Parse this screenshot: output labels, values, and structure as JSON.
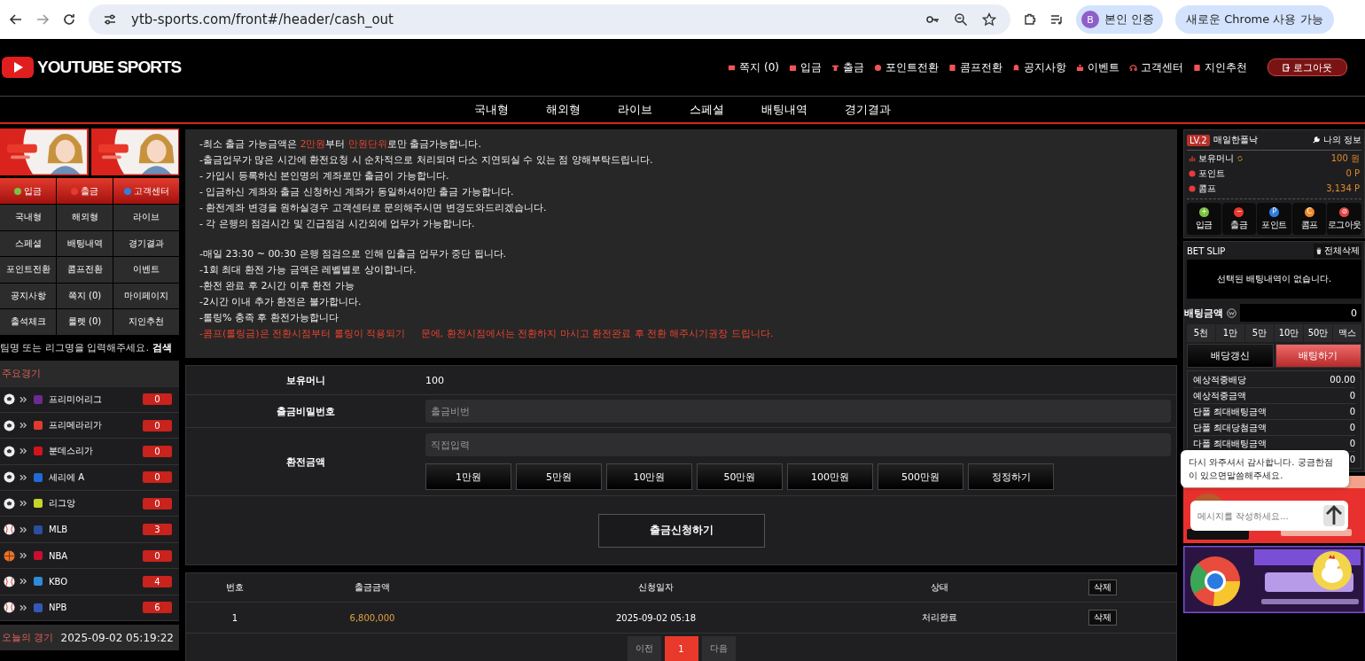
{
  "browser": {
    "url": "ytb-sports.com/front#/header/cash_out",
    "profile_initial": "B",
    "profile_label": "본인 인증",
    "update_label": "새로운 Chrome 사용 가능"
  },
  "header": {
    "logo": "YOUTUBE SPORTS",
    "links": [
      "쪽지 (0)",
      "입금",
      "출금",
      "포인트전환",
      "콤프전환",
      "공지사항",
      "이벤트",
      "고객센터",
      "지인추천"
    ],
    "logout": "로그아웃"
  },
  "menu": [
    "국내형",
    "해외형",
    "라이브",
    "스페셜",
    "배팅내역",
    "경기결과"
  ],
  "sidebar": {
    "banners": [
      {
        "kind": "picture"
      },
      {
        "kind": "picture"
      }
    ],
    "quick": [
      {
        "label": "입금",
        "color": "#7cc242"
      },
      {
        "label": "출금",
        "color": "#e8392b"
      },
      {
        "label": "고객센터",
        "color": "#2f7fe0"
      }
    ],
    "grid": [
      "국내형",
      "해외형",
      "라이브",
      "스페셜",
      "배팅내역",
      "경기결과",
      "포인트전환",
      "콤프전환",
      "이벤트",
      "공지사항",
      "쪽지 (0)",
      "마이페이지",
      "출석체크",
      "룰렛 (0)",
      "지인추천"
    ],
    "search": {
      "placeholder": "팀명 또는 리그명을 입력해주세요.",
      "button": "검색"
    },
    "major_title": "주요경기",
    "leagues": [
      {
        "kind": "soccer",
        "name": "프리미어리그",
        "count": "0",
        "color": "#6b2b8f"
      },
      {
        "kind": "soccer",
        "name": "프리메라리가",
        "count": "0",
        "color": "#e23b2e"
      },
      {
        "kind": "soccer",
        "name": "분데스리가",
        "count": "0",
        "color": "#d2141c"
      },
      {
        "kind": "soccer",
        "name": "세리에 A",
        "count": "0",
        "color": "#1e6bd6"
      },
      {
        "kind": "soccer",
        "name": "리그앙",
        "count": "0",
        "color": "#c7d42b"
      },
      {
        "kind": "baseball",
        "name": "MLB",
        "count": "3",
        "color": "#2a4ea0"
      },
      {
        "kind": "basketball",
        "name": "NBA",
        "count": "0",
        "color": "#c8102e"
      },
      {
        "kind": "baseball",
        "name": "KBO",
        "count": "4",
        "color": "#2e8bd9"
      },
      {
        "kind": "baseball",
        "name": "NPB",
        "count": "6",
        "color": "#3558b8"
      }
    ],
    "today_title": "오늘의 경기",
    "today_time": "2025-09-02 05:19:22"
  },
  "notices": [
    [
      [
        {
          "text": "-최소 출금 가능금액은 ",
          "red": false
        },
        {
          "text": "2만원",
          "red": true
        },
        {
          "text": "부터 ",
          "red": false
        },
        {
          "text": "만원단위",
          "red": true
        },
        {
          "text": "로만 출금가능합니다.",
          "red": false
        }
      ],
      [
        {
          "text": "-출금업무가 많은 시간에 환전요청 시 순차적으로 처리되며 다소 지연되실 수 있는 점 양해부탁드립니다.",
          "red": false
        }
      ],
      [
        {
          "text": "- 가입시 등록하신 본인명의 계좌로만 출금이 가능합니다.",
          "red": false
        }
      ],
      [
        {
          "text": "- 입금하신 계좌와 출금 신청하신 계좌가 동일하셔야만 출금 가능합니다.",
          "red": false
        }
      ],
      [
        {
          "text": "- 환전계좌 변경을 원하실경우 고객센터로 문의해주시면 변경도와드리겠습니다.",
          "red": false
        }
      ],
      [
        {
          "text": "- 각 은행의 점검시간 및 긴급점검 시간외에 업무가 가능합니다.",
          "red": false
        }
      ]
    ],
    [
      [
        {
          "text": "-매일 23:30 ~ 00:30 은행 점검으로 인해 입출금 업무가 중단 됩니다.",
          "red": false
        }
      ],
      [
        {
          "text": "-1회 최대 환전 가능 금액은 레벨별로 상이합니다.",
          "red": false
        }
      ],
      [
        {
          "text": "-환전 완료 후 2시간 이후 환전 가능",
          "red": false
        }
      ],
      [
        {
          "text": "-2시간 이내 추가 환전은 불가합니다.",
          "red": false
        }
      ],
      [
        {
          "text": "-롤링% 충족 후 환전가능합니다",
          "red": false
        }
      ],
      [
        {
          "text": "-콤프(롤링금)은 전환시점부터 롤링이 적용되기     문에, 환전시점에서는 전환하지 마시고 환전완료 후 전환 해주시기권장 드립니다.",
          "red": true
        }
      ]
    ]
  ],
  "form": {
    "balance_label": "보유머니",
    "balance": "100",
    "password_label": "출금비밀번호",
    "password_placeholder": "출금비번",
    "amount_label": "환전금액",
    "amount_placeholder": "직접입력",
    "amounts": [
      "1만원",
      "5만원",
      "10만원",
      "50만원",
      "100만원",
      "500만원",
      "정정하기"
    ],
    "submit": "출금신청하기"
  },
  "history": {
    "columns": [
      "번호",
      "출금금액",
      "신청일자",
      "상태"
    ],
    "delete_all": "삭제",
    "rows": [
      {
        "no": "1",
        "amount": "6,800,000",
        "date": "2025-09-02 05:18",
        "status": "처리완료",
        "delete": "삭제"
      }
    ],
    "pages": [
      {
        "label": "이전",
        "selected": false
      },
      {
        "label": "1",
        "selected": true
      },
      {
        "label": "다음",
        "selected": false
      }
    ]
  },
  "user": {
    "level": "LV.2",
    "name": "매일한폴낙",
    "info": "나의 정보",
    "stats": [
      {
        "label": "보유머니",
        "value": "100 원"
      },
      {
        "label": "포인트",
        "value": "0 P"
      },
      {
        "label": "콤프",
        "value": "3,134 P"
      }
    ],
    "actions": [
      {
        "label": "입금",
        "color": "#7cc242",
        "glyph": "+"
      },
      {
        "label": "출금",
        "color": "#e8392b",
        "glyph": "−"
      },
      {
        "label": "포인트",
        "color": "#2f7fe0",
        "glyph": "P"
      },
      {
        "label": "콤프",
        "color": "#f08a2c",
        "glyph": "C"
      },
      {
        "label": "로그아웃",
        "color": "#e84545",
        "glyph": "⊘"
      }
    ]
  },
  "betslip": {
    "title": "BET SLIP",
    "clear": "전체삭제",
    "empty": "선택된 배팅내역이 없습니다.",
    "amount_label": "배팅금액",
    "amount": "0",
    "chips": [
      "5천",
      "1만",
      "5만",
      "10만",
      "50만",
      "맥스"
    ],
    "refresh": "배당갱신",
    "place": "배팅하기",
    "stats": [
      {
        "label": "예상적중배당",
        "value": "00.00"
      },
      {
        "label": "예상적중금액",
        "value": "0"
      },
      {
        "label": "단폴 최대배팅금액",
        "value": "0"
      },
      {
        "label": "단폴 최대당첨금액",
        "value": "0"
      },
      {
        "label": "다폴 최대배팅금액",
        "value": "0"
      }
    ],
    "hidden_stat_value": "0"
  },
  "promo_banners": [
    {
      "kind": "picture"
    },
    {
      "kind": "picture"
    }
  ],
  "chat": {
    "message": "다시 와주셔서 감사합니다. 궁금한점이 있으면말씀해주세요.",
    "placeholder": "메시지를 작성하세요..."
  }
}
